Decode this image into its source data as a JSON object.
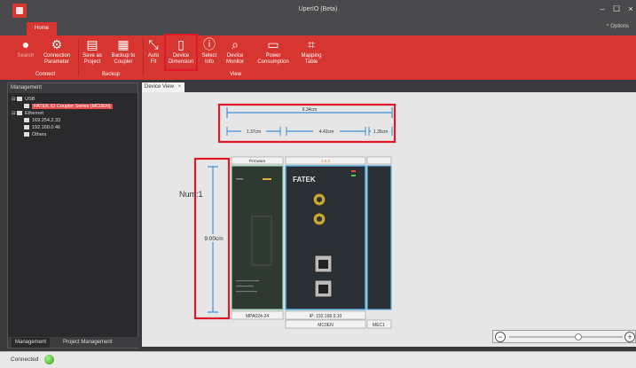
{
  "window": {
    "title": "UperIO (Beta)",
    "minimize": "–",
    "maximize": "☐",
    "close": "×"
  },
  "tabs": {
    "home": "Home",
    "options": "^  Options"
  },
  "ribbon": {
    "connect": {
      "search": "Search",
      "connection_parameter": "Connection Parameter",
      "group": "Connect"
    },
    "backup": {
      "save_as_project": "Save as Project",
      "backup_to_coupler": "Backup to Coupler",
      "group": "Backup"
    },
    "view": {
      "auto_fit": "Auto Fit",
      "device_dimension": "Device Dimension",
      "select_info": "Select Info",
      "device_monitor": "Device Monitor",
      "power_consumption": "Power Consumption",
      "mapping_table": "Mapping Table",
      "group": "View"
    }
  },
  "left_panel": {
    "header": "Management",
    "tree": [
      {
        "label": "USB",
        "level": 0
      },
      {
        "label": "FATEK IO Coupler Series (MC0EN)",
        "level": 1,
        "selected": true
      },
      {
        "label": "Ethernet",
        "level": 0
      },
      {
        "label": "169.254.2.33",
        "level": 1
      },
      {
        "label": "192.168.0.46",
        "level": 1
      },
      {
        "label": "Others",
        "level": 1
      }
    ],
    "bottom_tabs": [
      "Management",
      "Project Management"
    ]
  },
  "document": {
    "tab_label": "Device View",
    "tab_close": "×"
  },
  "device_view": {
    "total_width": "6.34cm",
    "seg_widths": [
      "1.37cm",
      "4.42cm",
      "1.35cm"
    ],
    "height": "9.00cm",
    "num_label": "Num:1",
    "modules": [
      {
        "top_label": "Firmware",
        "bottom_label": "MPA024-24"
      },
      {
        "top_label": "1.0.2",
        "brand": "FATEK",
        "bottom_label1": "IP: 192.168.0.10",
        "bottom_label2": "MC0EN"
      },
      {
        "top_label": "",
        "bottom_label": "MEC1"
      }
    ]
  },
  "status": {
    "text": "Connected"
  },
  "colors": {
    "accent": "#d7352f",
    "highlight": "#e0182a",
    "dimension": "#3f8fd8"
  }
}
